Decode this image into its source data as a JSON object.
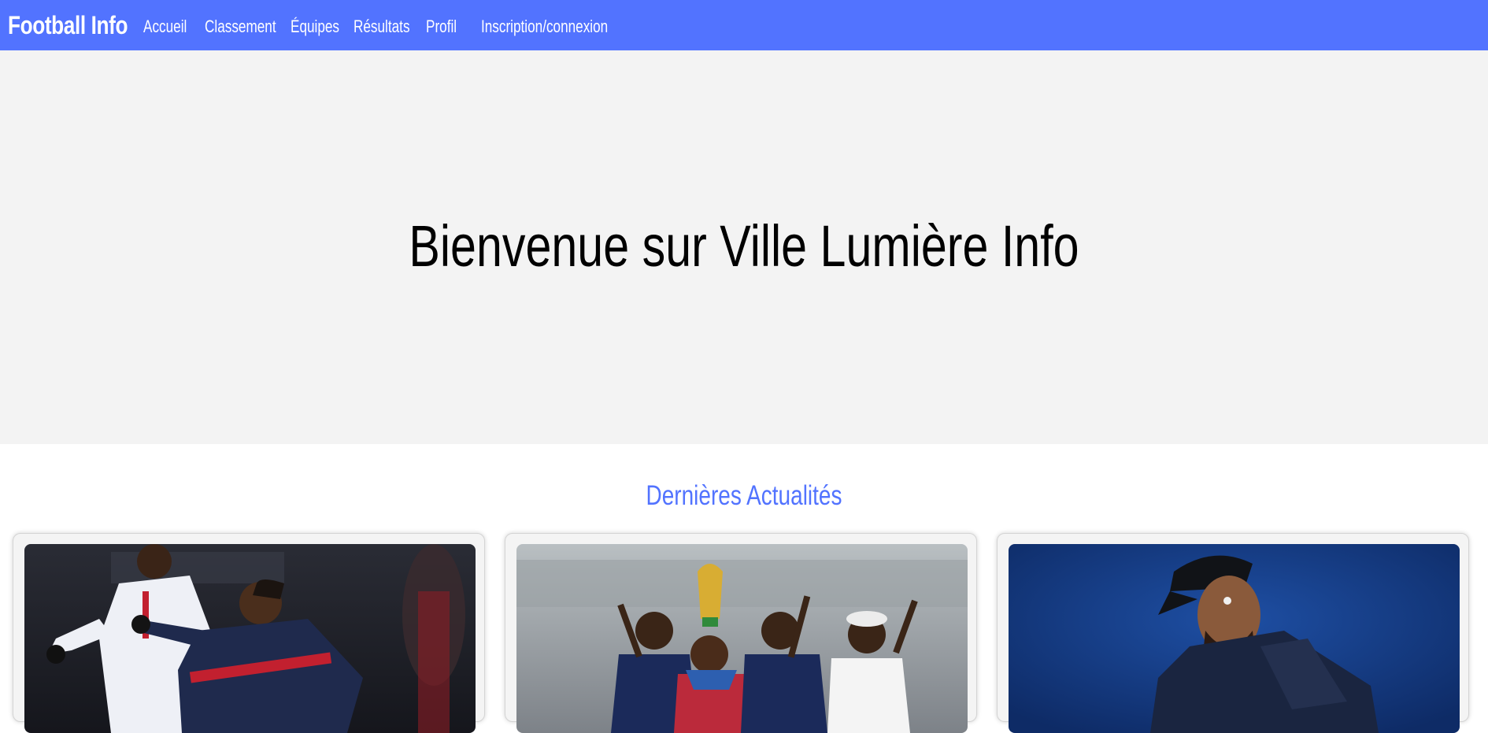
{
  "header": {
    "brand": "Football Info",
    "nav": [
      {
        "label": "Accueil"
      },
      {
        "label": "Classement"
      },
      {
        "label": "Équipes"
      },
      {
        "label": "Résultats"
      },
      {
        "label": "Profil"
      },
      {
        "label": "Inscription/connexion"
      }
    ]
  },
  "hero": {
    "title": "Bienvenue sur Ville Lumière Info"
  },
  "news": {
    "title": "Dernières Actualités",
    "cards": [
      {
        "image": "football-match-photo"
      },
      {
        "image": "world-cup-celebration-photo"
      },
      {
        "image": "player-portrait-photo"
      }
    ]
  },
  "colors": {
    "accent": "#5273ff",
    "hero_bg": "#f3f3f3",
    "page_bg": "#ffffff"
  }
}
